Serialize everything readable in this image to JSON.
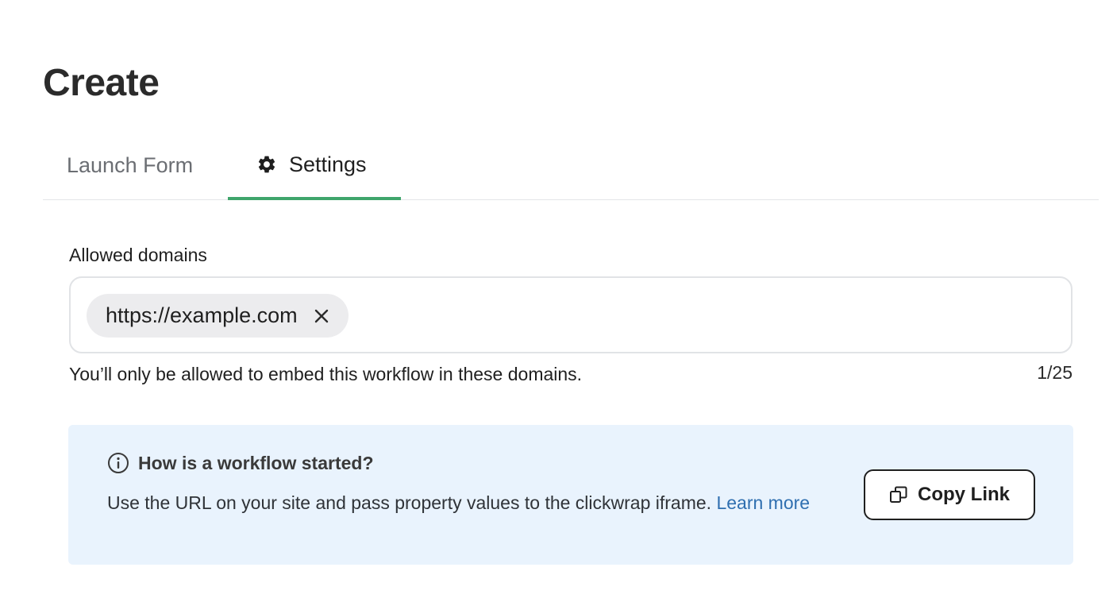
{
  "page": {
    "title": "Create"
  },
  "tabs": [
    {
      "label": "Launch Form",
      "icon": null,
      "active": false
    },
    {
      "label": "Settings",
      "icon": "gear-icon",
      "active": true
    }
  ],
  "allowed_domains": {
    "label": "Allowed domains",
    "chips": [
      {
        "value": "https://example.com",
        "remove_icon": "close-icon"
      }
    ],
    "helper": "You’ll only be allowed to embed this workflow in these domains.",
    "counter": "1/25"
  },
  "info": {
    "icon": "info-icon",
    "title": "How is a workflow started?",
    "description": "Use the URL on your site and pass property values to the clickwrap iframe. ",
    "link_label": "Learn more",
    "copy_button": {
      "label": "Copy Link",
      "icon": "copy-icon"
    }
  },
  "colors": {
    "active_tab_underline": "#3fa56b",
    "info_background": "#e9f3fd",
    "link": "#2f6fb0",
    "chip_background": "#ececee"
  }
}
